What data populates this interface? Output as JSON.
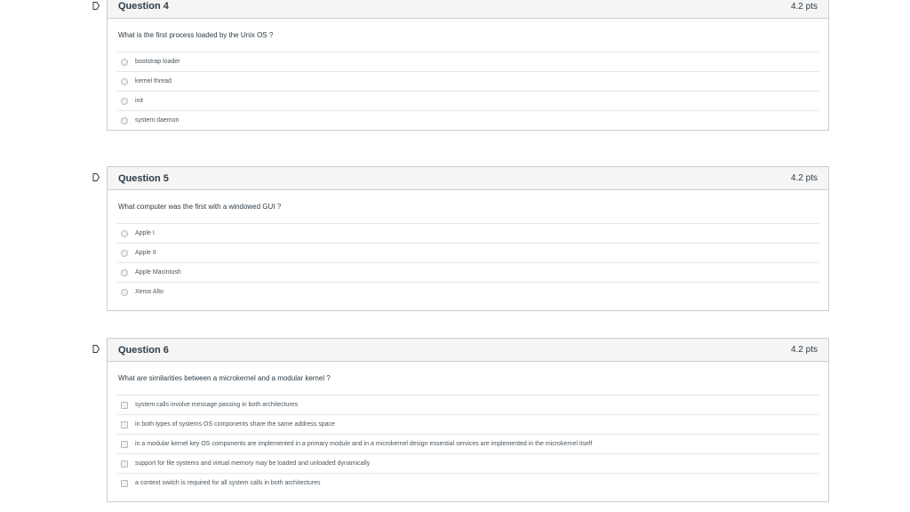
{
  "questions": [
    {
      "title": "Question 4",
      "points": "4.2 pts",
      "prompt": "What is the first process loaded by the Unix OS ?",
      "type": "radio",
      "answers": [
        "bootstrap loader",
        "kernel thread",
        "init",
        "system daemon"
      ]
    },
    {
      "title": "Question 5",
      "points": "4.2 pts",
      "prompt": "What computer was the first with a windowed GUI ?",
      "type": "radio",
      "answers": [
        "Apple I",
        "Apple II",
        "Apple Macintosh",
        "Xerox Alto"
      ]
    },
    {
      "title": "Question 6",
      "points": "4.2 pts",
      "prompt": "What are similarities between a microkernel and a modular kernel ?",
      "type": "checkbox",
      "answers": [
        "system calls involve message passing in both architectures",
        "in both types of systems OS components share the same address space",
        "in a modular kernel key OS components are implemented in a primary module and in a microkernel design essential services are implemented in the microkernel itself",
        "support for file systems and virtual memory may be loaded and unloaded dynamically",
        "a context switch is required for all system calls in both architectures"
      ]
    }
  ]
}
